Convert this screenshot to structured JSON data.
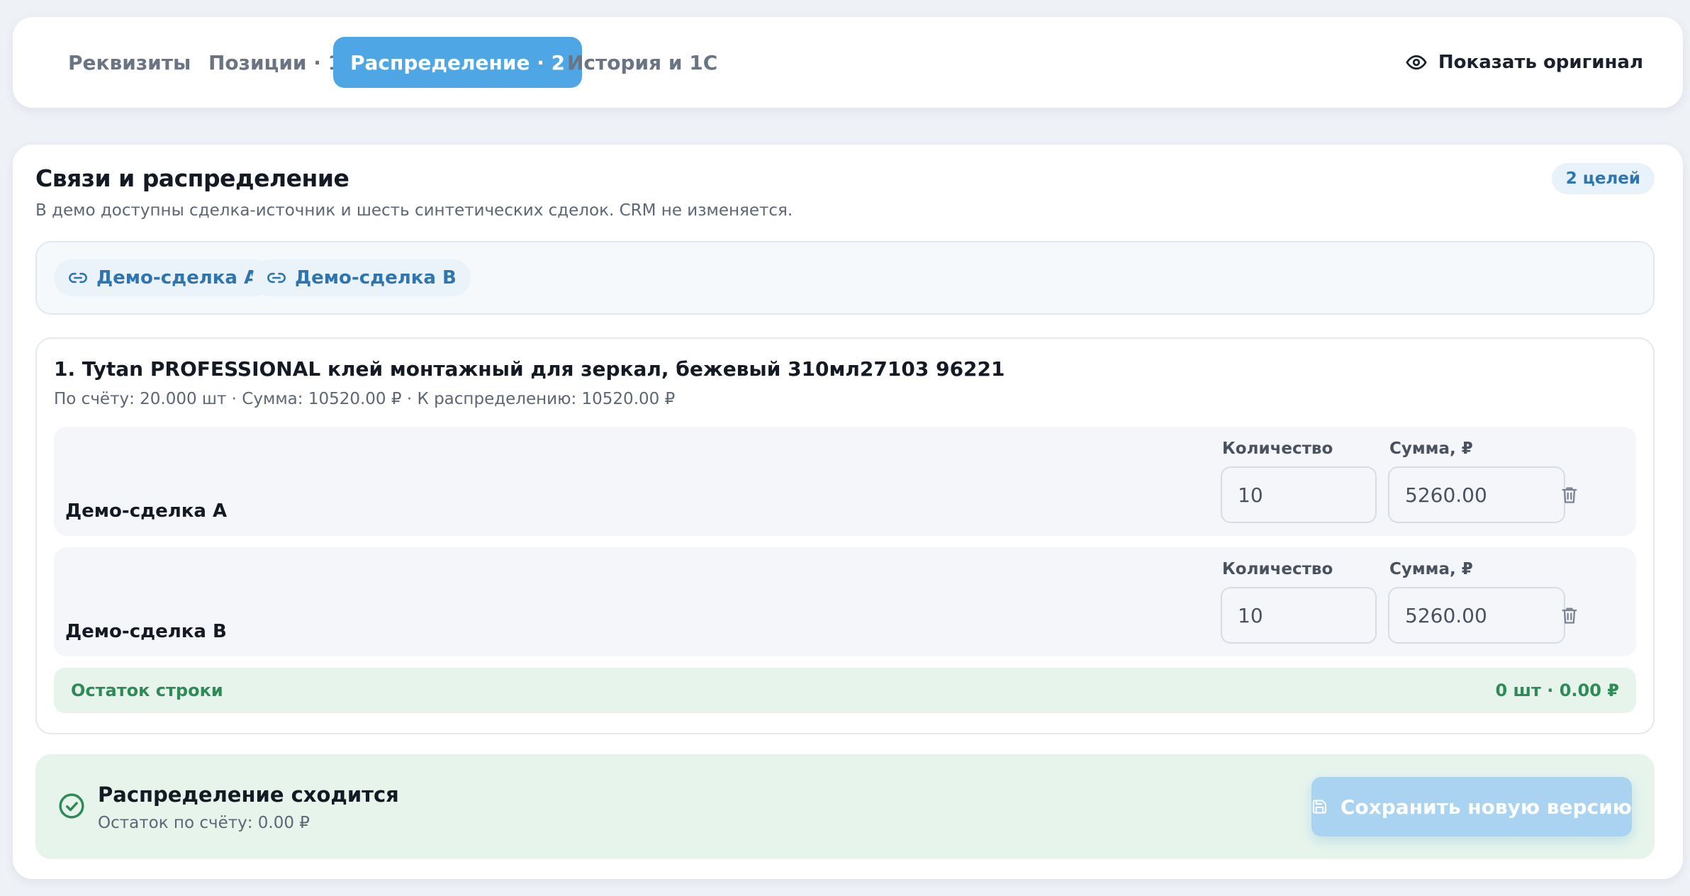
{
  "tabs": [
    {
      "label": "Реквизиты"
    },
    {
      "label": "Позиции · 1"
    },
    {
      "label": "Распределение · 2"
    },
    {
      "label": "История и 1С"
    }
  ],
  "header": {
    "show_original_label": "Показать оригинал"
  },
  "section": {
    "title": "Связи и распределение",
    "subtitle": "В демо доступны сделка-источник и шесть синтетических сделок. CRM не изменяется.",
    "badge": "2 целей"
  },
  "links": [
    {
      "label": "Демо-сделка A"
    },
    {
      "label": "Демо-сделка B"
    }
  ],
  "item": {
    "title": "1. Tytan PROFESSIONAL клей монтажный для зеркал, бежевый 310мл27103 96221",
    "meta": "По счёту: 20.000 шт · Сумма: 10520.00 ₽ · К распределению: 10520.00 ₽",
    "allocations": [
      {
        "deal": "Демо-сделка A",
        "qty_label": "Количество",
        "sum_label": "Сумма, ₽",
        "qty": "10",
        "sum": "5260.00"
      },
      {
        "deal": "Демо-сделка B",
        "qty_label": "Количество",
        "sum_label": "Сумма, ₽",
        "qty": "10",
        "sum": "5260.00"
      }
    ],
    "remainder_label": "Остаток строки",
    "remainder_value": "0 шт · 0.00 ₽"
  },
  "status": {
    "title": "Распределение сходится",
    "subtitle": "Остаток по счёту: 0.00 ₽",
    "save_label": "Сохранить новую версию"
  },
  "icons": {
    "show_original": "eye-icon",
    "link": "link-icon",
    "delete": "trash-icon",
    "status": "check-circle-icon",
    "save": "floppy-disk-icon"
  },
  "colors": {
    "accent": "#4fa6e5",
    "link": "#2f76b0",
    "success": "#2e8a56",
    "success_bg": "#e6f4ec"
  }
}
